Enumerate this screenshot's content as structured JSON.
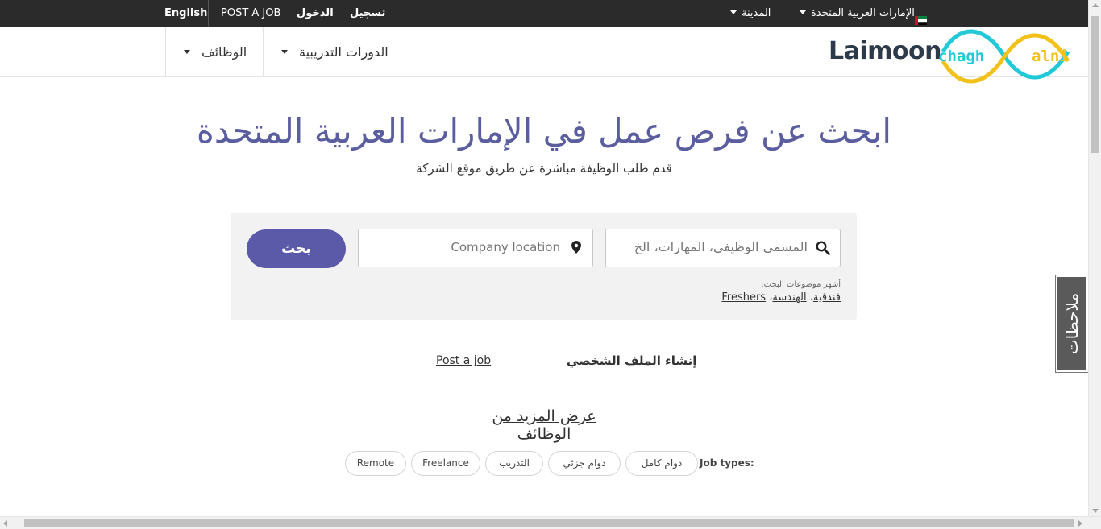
{
  "topbar": {
    "english": "English",
    "post_job": "POST A JOB",
    "login": "الدخول",
    "register": "تسجيل",
    "city": "المدينة",
    "country": "الإمارات العربية المتحدة"
  },
  "nav": {
    "jobs": "الوظائف",
    "courses": "الدورات التدريبية",
    "logo": "Laimoon",
    "watermark": "chaghalni"
  },
  "hero": {
    "title": "ابحث عن فرص عمل في الإمارات العربية المتحدة",
    "subtitle": "قدم طلب الوظيفة مباشرة عن طريق موقع الشركة"
  },
  "search": {
    "keyword_placeholder": "المسمى الوظيفي، المهارات، الخ",
    "location_placeholder": "Company location",
    "button": "بحث",
    "popular_label": "أشهر موضوعات البحث:",
    "popular": [
      "فندقية",
      "الهندسة",
      "Freshers"
    ]
  },
  "links": {
    "create_profile": "إنشاء الملف الشخصي",
    "post_job": "Post a job",
    "view_more": "عرض المزيد من الوظائف"
  },
  "job_types": {
    "label": "Job types:",
    "chips": [
      "دوام كامل",
      "دوام جزئي",
      "التدريب",
      "Freelance",
      "Remote"
    ]
  },
  "feedback": "ملاحظات",
  "colors": {
    "accent": "#5a5aa8",
    "title": "#5a5e9f",
    "topbar": "#2b2b2b"
  }
}
